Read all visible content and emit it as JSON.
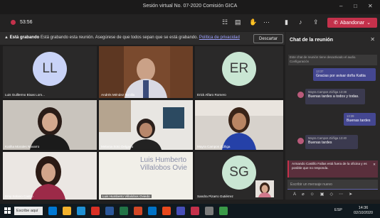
{
  "window": {
    "title": "Sesión virtual No. 07-2020 Comisión GICA"
  },
  "toolbar": {
    "timer": "53:56",
    "leave_label": "Abandonar"
  },
  "banner": {
    "bold": "Está grabando",
    "text": "Está grabando esta reunión. Asegúrese de que todos sepan que se está grabando.",
    "link": "Política de privacidad",
    "dismiss": "Descartar"
  },
  "participants": [
    {
      "name": "Luis Guillermo Bixas Lom...",
      "initials": "LL",
      "avatar_color": "#c9d3f7"
    },
    {
      "name": "Andrés Méndez Bonilla",
      "initials": "",
      "avatar_color": ""
    },
    {
      "name": "Erick Alfaro Romero",
      "initials": "ER",
      "avatar_color": "#c9e6d3"
    },
    {
      "name": "Katiha Morales Navarro",
      "initials": "",
      "avatar_color": ""
    },
    {
      "name": "Melania Soto Delgado",
      "initials": "",
      "avatar_color": ""
    },
    {
      "name": "Mayra Campos Zúñiga",
      "initials": "",
      "avatar_color": ""
    },
    {
      "name": "Emy Solano Castro",
      "initials": "",
      "avatar_color": ""
    },
    {
      "name": "Luis Humberto Villalobos Oviedo",
      "initials": "",
      "avatar_color": "",
      "overlay_text": "Luis Humberto Villalobos Ovie"
    },
    {
      "name": "Sandra Pizarro Gutiérrez",
      "initials": "SG",
      "avatar_color": "#c9e6d3"
    }
  ],
  "chat": {
    "title": "Chat de la reunión",
    "system_message": "Este chat de reunión tiene desactivado el audio. Configuración",
    "messages": [
      {
        "author": "",
        "time": "13:37",
        "text": "Gracias por avisar doña Kattia",
        "mine": true
      },
      {
        "author": "Mayra Campos Zúñiga",
        "time": "13:38",
        "text": "Buenas tardes a todos y todas.",
        "mine": false
      },
      {
        "author": "",
        "time": "13:39",
        "text": "Buenas tardes",
        "mine": true
      },
      {
        "author": "Mayra Campos Zúñiga",
        "time": "13:40",
        "text": "Buenas tardes",
        "mine": false
      }
    ],
    "alert": "Armando Castillo Fallas está fuera de la oficina y es posible que no responda.",
    "compose_placeholder": "Escribir un mensaje nuevo"
  },
  "taskbar": {
    "search_placeholder": "Escribe aquí",
    "time": "14:36",
    "date": "02/10/2020",
    "lang": "ESP"
  }
}
